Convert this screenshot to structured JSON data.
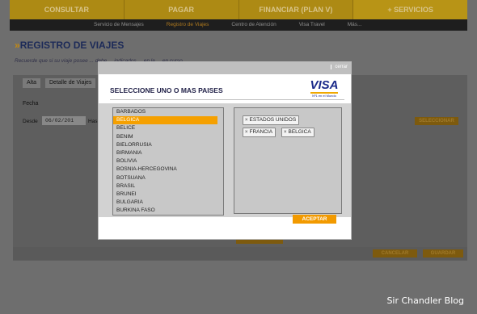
{
  "top_nav": [
    "CONSULTAR",
    "PAGAR",
    "FINANCIAR (PLAN V)",
    "+ SERVICIOS"
  ],
  "sub_nav": [
    "Servicio de Mensajes",
    "Registro de Viajes",
    "Centro de Atención",
    "Visa Travel",
    "Más..."
  ],
  "sub_nav_active": 1,
  "page": {
    "title": "REGISTRO DE VIAJES",
    "arrow": "»",
    "hint": "Recuerde que si su viaje posee ... debe ... indicados ... en la ... en curso."
  },
  "tabs": [
    "Alta",
    "Detalle de Viajes"
  ],
  "form": {
    "fecha_label": "Fecha",
    "desde_label": "Desde",
    "desde_value": "06/02/201",
    "hasta_label": "Has",
    "seleccionar": "SELECCIONAR",
    "cancelar": "CANCELAR",
    "guardar": "GUARDAR"
  },
  "modal": {
    "close_label": "cerrar",
    "title": "SELECCIONE UNO O MAS PAISES",
    "visa": {
      "word": "VISA",
      "tagline": "Nº1 en el Mundo"
    },
    "countries": [
      "BARBADOS",
      "BELGICA",
      "BELICE",
      "BENIM",
      "BIELORRUSIA",
      "BIRMANIA",
      "BOLIVIA",
      "BOSNIA-HERCEGOVINA",
      "BOTSUANA",
      "BRASIL",
      "BRUNEI",
      "BULGARIA",
      "BURKINA FASO"
    ],
    "selected_country_index": 1,
    "chips": [
      "ESTADOS UNIDOS",
      "FRANCIA",
      "BELGICA"
    ],
    "chip_remove_glyph": "×",
    "accept_label": "ACEPTAR"
  },
  "watermark": "Sir Chandler Blog",
  "colors": {
    "accent": "#f29a00",
    "brand_blue": "#1a2a8a",
    "selection": "#f5a000"
  }
}
